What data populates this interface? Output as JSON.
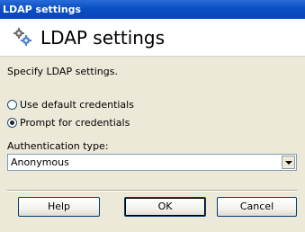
{
  "window": {
    "title": "LDAP settings"
  },
  "header": {
    "title": "LDAP settings",
    "icon": "ldap-settings-icon"
  },
  "content": {
    "description": "Specify LDAP settings.",
    "credentials": [
      {
        "label": "Use default credentials",
        "checked": false
      },
      {
        "label": "Prompt for credentials",
        "checked": true
      }
    ],
    "auth_type_label": "Authentication type:",
    "auth_type_value": "Anonymous"
  },
  "buttons": {
    "help": "Help",
    "ok": "OK",
    "cancel": "Cancel"
  },
  "colors": {
    "titlebar": "#0a4fc4",
    "dialog_bg": "#ece9d8",
    "button_border": "#003c74"
  }
}
